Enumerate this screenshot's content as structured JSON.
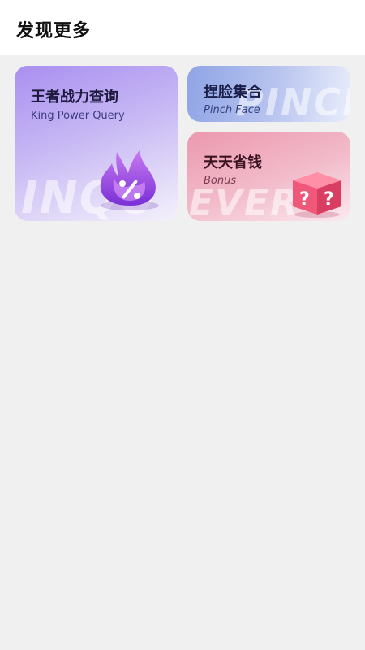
{
  "header": {
    "title": "发现更多"
  },
  "cards": [
    {
      "title": "王者战力查询",
      "subtitle": "King Power Query",
      "watermark": "INQU",
      "icon": "fire-percent-icon"
    },
    {
      "title": "捏脸集合",
      "subtitle": "Pinch Face",
      "watermark": "PINCH",
      "icon": ""
    },
    {
      "title": "天天省钱",
      "subtitle": "Bonus",
      "watermark": "EVER",
      "icon": "question-cube-icon"
    }
  ],
  "colors": {
    "king_card": "#b7a3f2",
    "pinch_card": "#a9b8ec",
    "bonus_card": "#f0aabd",
    "background": "#f0f0f0"
  }
}
